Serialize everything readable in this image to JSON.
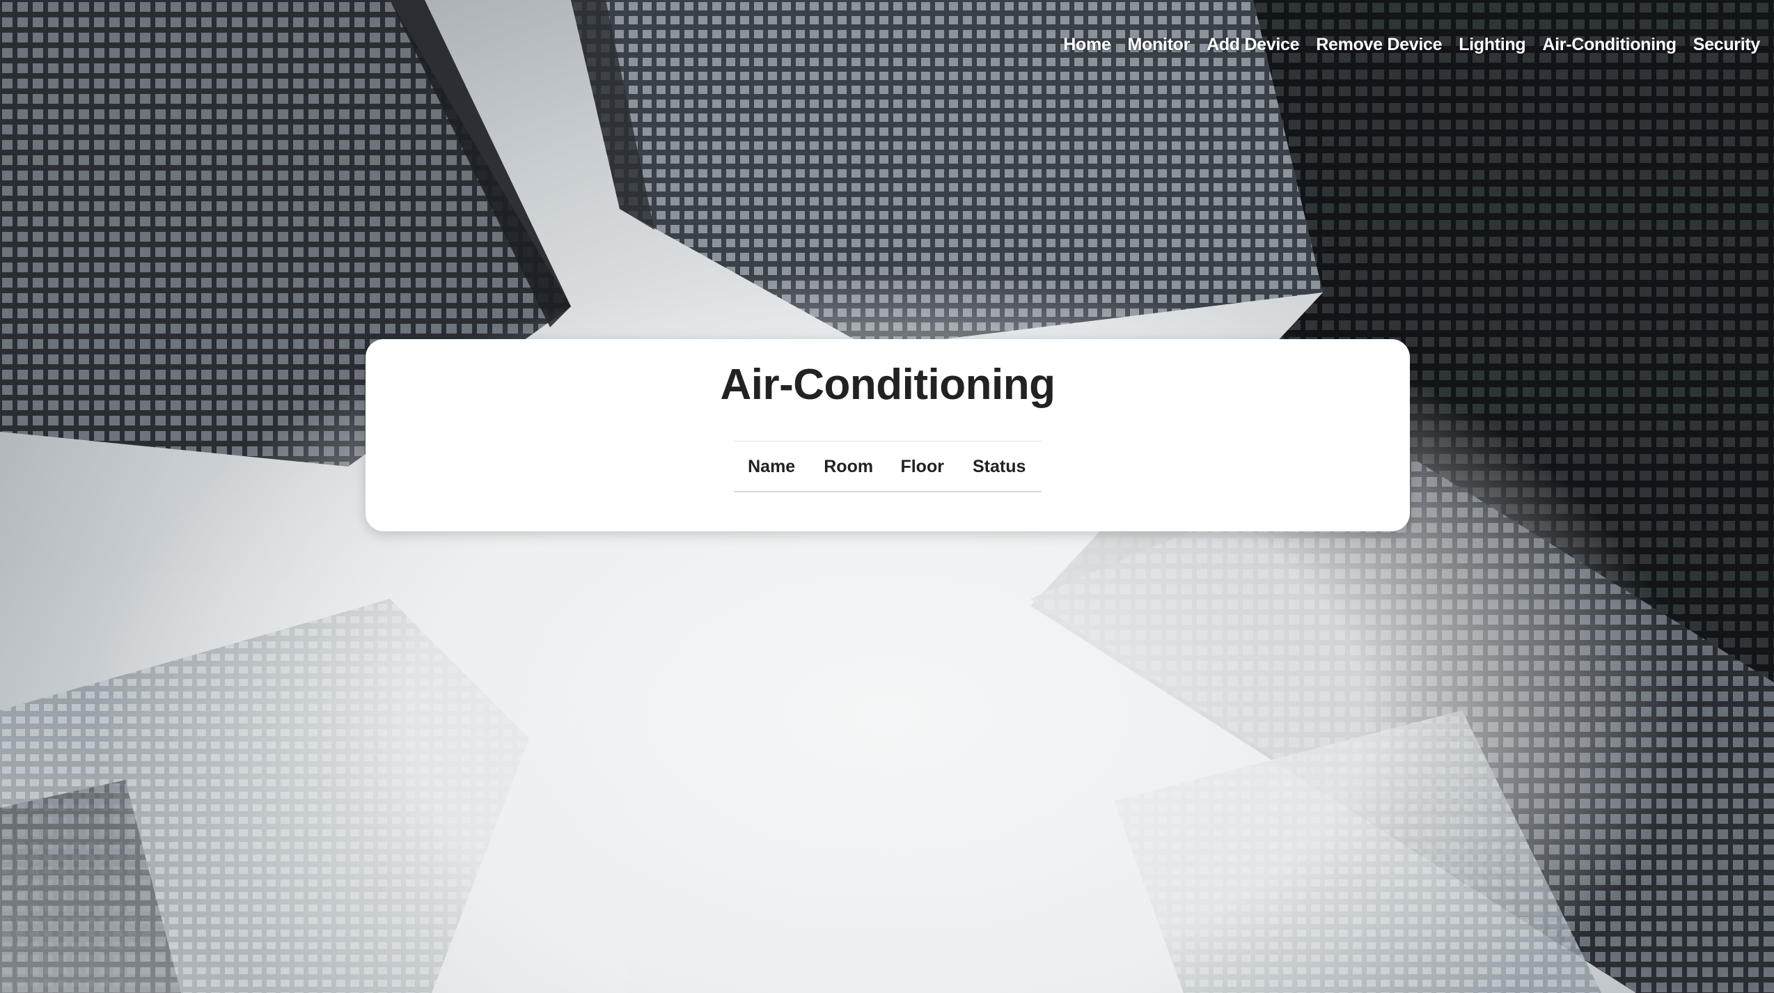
{
  "nav": {
    "items": [
      {
        "label": "Home"
      },
      {
        "label": "Monitor"
      },
      {
        "label": "Add Device"
      },
      {
        "label": "Remove Device"
      },
      {
        "label": "Lighting"
      },
      {
        "label": "Air-Conditioning"
      },
      {
        "label": "Security"
      }
    ]
  },
  "page": {
    "title": "Air-Conditioning"
  },
  "table": {
    "columns": [
      "Name",
      "Room",
      "Floor",
      "Status"
    ],
    "rows": []
  },
  "background": {
    "description_icon": "skyscrapers-photo"
  },
  "colors": {
    "card_bg": "#ffffff",
    "title_text": "#222222",
    "nav_text": "#ffffff"
  }
}
